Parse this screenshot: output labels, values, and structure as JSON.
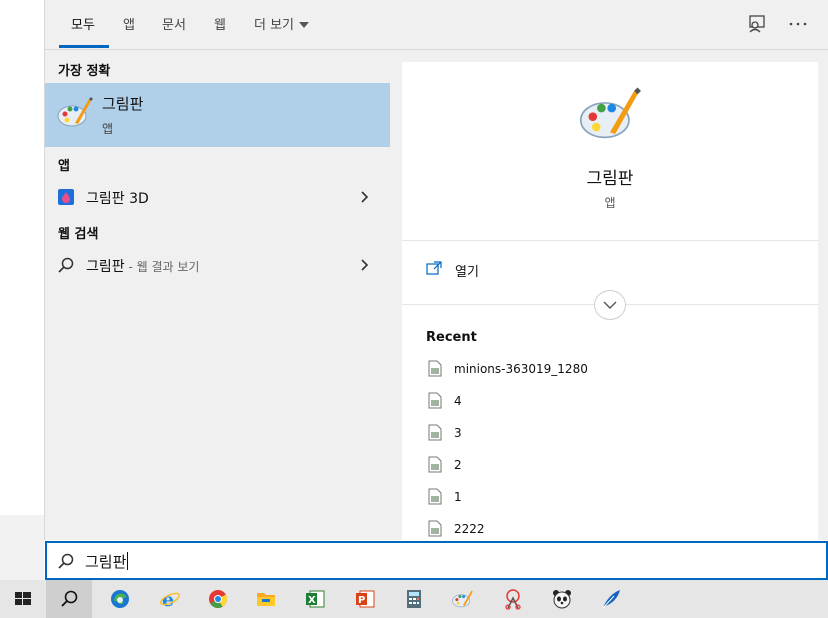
{
  "tabs": [
    {
      "label": "모두"
    },
    {
      "label": "앱"
    },
    {
      "label": "문서"
    },
    {
      "label": "웹"
    },
    {
      "label": "더 보기"
    }
  ],
  "sections": {
    "best_match": "가장 정확",
    "apps": "앱",
    "web": "웹 검색"
  },
  "best_match": {
    "title": "그림판",
    "subtitle": "앱"
  },
  "apps": [
    {
      "label": "그림판 3D"
    }
  ],
  "web": {
    "query": "그림판",
    "suffix": " - 웹 결과 보기"
  },
  "preview": {
    "title": "그림판",
    "subtitle": "앱",
    "open_label": "열기",
    "recent_label": "Recent",
    "recent_files": [
      "minions-363019_1280",
      "4",
      "3",
      "2",
      "1",
      "2222"
    ]
  },
  "search": {
    "value": "그림판"
  },
  "colors": {
    "accent": "#0067c0",
    "selection": "#b0cfe9"
  },
  "taskbar": [
    "windows-start-icon",
    "search-icon",
    "edge-icon",
    "internet-explorer-icon",
    "chrome-icon",
    "file-explorer-icon",
    "excel-icon",
    "powerpoint-icon",
    "calculator-icon",
    "paint-icon",
    "snipping-tool-icon",
    "panda-icon",
    "feather-icon"
  ]
}
